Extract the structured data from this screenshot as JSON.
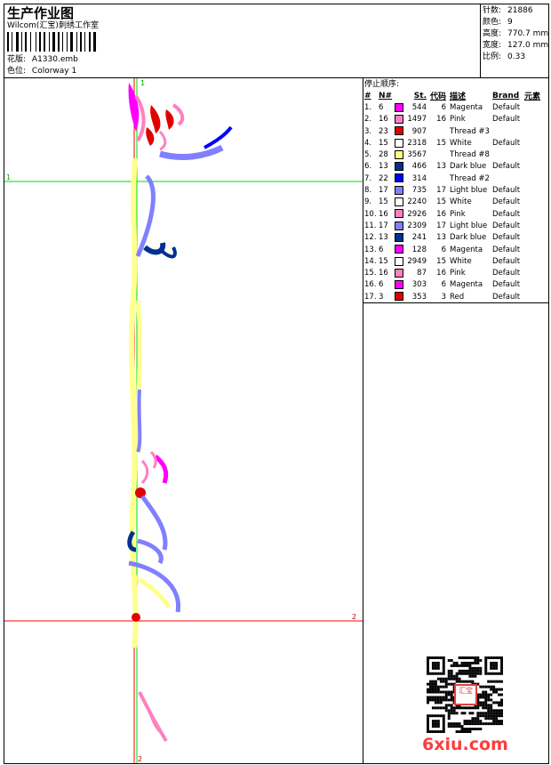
{
  "header": {
    "title": "生产作业图",
    "company": "Wilcom(汇宝)刺绣工作室",
    "design_label": "花版:",
    "design_value": "A1330.emb",
    "colorway_label": "色位:",
    "colorway_value": "Colorway 1"
  },
  "stats": [
    {
      "label": "针数:",
      "value": "21886"
    },
    {
      "label": "颜色:",
      "value": "9"
    },
    {
      "label": "高度:",
      "value": "770.7 mm"
    },
    {
      "label": "宽度:",
      "value": "127.0 mm"
    },
    {
      "label": "比例:",
      "value": "0.33"
    }
  ],
  "stop_sequence": {
    "title": "停止顺序:",
    "columns": [
      "#",
      "N#",
      "St.",
      "代码",
      "描述",
      "Brand",
      "元素"
    ],
    "rows": [
      {
        "idx": "1.",
        "n": "6",
        "color": "#ff00ff",
        "st": "544",
        "code": "6",
        "desc": "Magenta",
        "brand": "Default"
      },
      {
        "idx": "2.",
        "n": "16",
        "color": "#ff80c0",
        "st": "1497",
        "code": "16",
        "desc": "Pink",
        "brand": "Default"
      },
      {
        "idx": "3.",
        "n": "23",
        "color": "#e00000",
        "st": "907",
        "code": "",
        "desc": "Thread #3",
        "brand": ""
      },
      {
        "idx": "4.",
        "n": "15",
        "color": "#ffffff",
        "st": "2318",
        "code": "15",
        "desc": "White",
        "brand": "Default"
      },
      {
        "idx": "5.",
        "n": "28",
        "color": "#ffff80",
        "st": "3567",
        "code": "",
        "desc": "Thread #8",
        "brand": ""
      },
      {
        "idx": "6.",
        "n": "13",
        "color": "#003090",
        "st": "466",
        "code": "13",
        "desc": "Dark blue",
        "brand": "Default"
      },
      {
        "idx": "7.",
        "n": "22",
        "color": "#0000ff",
        "st": "314",
        "code": "",
        "desc": "Thread #2",
        "brand": ""
      },
      {
        "idx": "8.",
        "n": "17",
        "color": "#8080ff",
        "st": "735",
        "code": "17",
        "desc": "Light blue",
        "brand": "Default"
      },
      {
        "idx": "9.",
        "n": "15",
        "color": "#ffffff",
        "st": "2240",
        "code": "15",
        "desc": "White",
        "brand": "Default"
      },
      {
        "idx": "10.",
        "n": "16",
        "color": "#ff80c0",
        "st": "2926",
        "code": "16",
        "desc": "Pink",
        "brand": "Default"
      },
      {
        "idx": "11.",
        "n": "17",
        "color": "#8080ff",
        "st": "2309",
        "code": "17",
        "desc": "Light blue",
        "brand": "Default"
      },
      {
        "idx": "12.",
        "n": "13",
        "color": "#003090",
        "st": "241",
        "code": "13",
        "desc": "Dark blue",
        "brand": "Default"
      },
      {
        "idx": "13.",
        "n": "6",
        "color": "#ff00ff",
        "st": "128",
        "code": "6",
        "desc": "Magenta",
        "brand": "Default"
      },
      {
        "idx": "14.",
        "n": "15",
        "color": "#ffffff",
        "st": "2949",
        "code": "15",
        "desc": "White",
        "brand": "Default"
      },
      {
        "idx": "15.",
        "n": "16",
        "color": "#ff80c0",
        "st": "87",
        "code": "16",
        "desc": "Pink",
        "brand": "Default"
      },
      {
        "idx": "16.",
        "n": "6",
        "color": "#ff00ff",
        "st": "303",
        "code": "6",
        "desc": "Magenta",
        "brand": "Default"
      },
      {
        "idx": "17.",
        "n": "3",
        "color": "#e00000",
        "st": "353",
        "code": "3",
        "desc": "Red",
        "brand": "Default"
      }
    ]
  },
  "guides": {
    "green_h_label": "1",
    "green_v_label": "1",
    "red_h_label": "2",
    "red_v_label": "2"
  },
  "watermark": {
    "text": "6xiu.com",
    "seal_text": "汇宝"
  },
  "colors": {
    "guide_green": "#00dd00",
    "guide_red": "#ff0000",
    "watermark": "#ff3c3c"
  }
}
